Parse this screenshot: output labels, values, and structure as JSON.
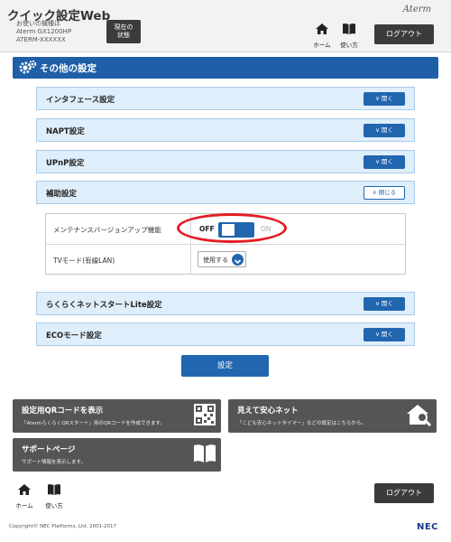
{
  "header": {
    "app_title": "クイック設定Web",
    "device_label": "お使いの機種は",
    "device_model": "Aterm GX1200HP",
    "device_ssid": "ATERM-XXXXXX",
    "status_button_line1": "現在の",
    "status_button_line2": "状態",
    "brand": "Aterm",
    "home_label": "ホーム",
    "help_label": "使い方",
    "logout_label": "ログアウト"
  },
  "page": {
    "section_title": "その他の設定"
  },
  "accordions": [
    {
      "label": "インタフェース設定",
      "button": "開く"
    },
    {
      "label": "NAPT設定",
      "button": "開く"
    },
    {
      "label": "UPnP設定",
      "button": "開く"
    },
    {
      "label": "補助設定",
      "button": "閉じる"
    },
    {
      "label": "らくらくネットスタートLite設定",
      "button": "開く"
    },
    {
      "label": "ECOモード設定",
      "button": "開く"
    }
  ],
  "settings": {
    "maintenance_label": "メンテナンスバージョンアップ機能",
    "toggle_off": "OFF",
    "toggle_on": "ON",
    "toggle_state": "OFF",
    "tv_mode_label": "TVモード(有線LAN)",
    "tv_mode_value": "使用する"
  },
  "submit_label": "設定",
  "tiles": {
    "qr_title": "設定用QRコードを表示",
    "qr_desc": "「AtermらくらくQRスタート」用のQRコードを作成できます。",
    "safe_title": "見えて安心ネット",
    "safe_desc": "「こども安心ネットタイマー」などの設定はこちらから。",
    "support_title": "サポートページ",
    "support_desc": "サポート情報を表示します。"
  },
  "footer": {
    "home_label": "ホーム",
    "help_label": "使い方",
    "logout_label": "ログアウト",
    "copyright": "Copyright© NEC Platforms, Ltd. 2001-2017",
    "maker": "NEC"
  },
  "colors": {
    "accent": "#2266b0",
    "section_bar": "#1f5fa8",
    "accordion_bg": "#dfeefb",
    "tile_bg": "#555555",
    "highlight_ring": "#e31e24"
  }
}
